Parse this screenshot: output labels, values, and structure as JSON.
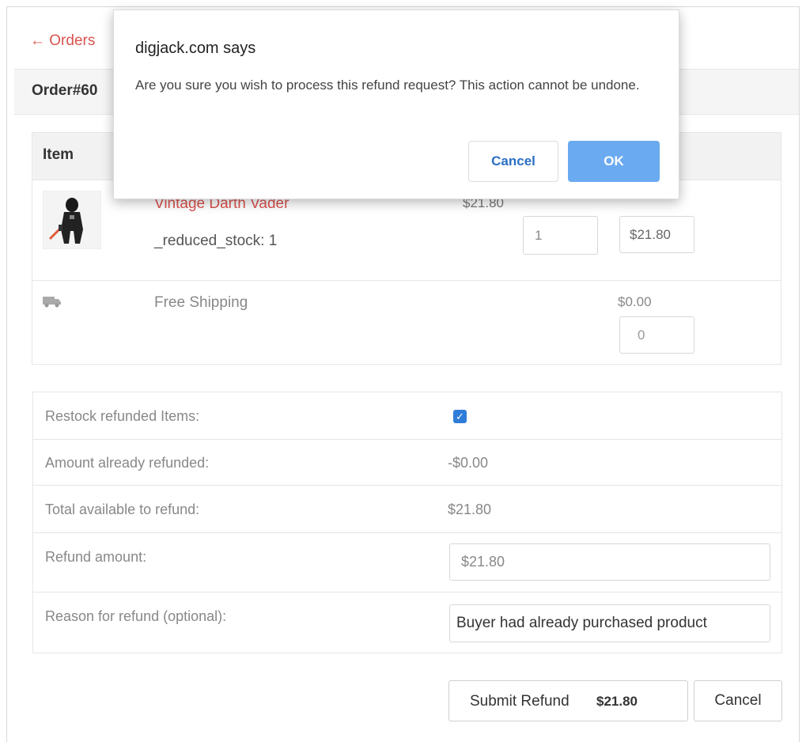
{
  "nav": {
    "back_label": "← Orders"
  },
  "order": {
    "title": "Order#60"
  },
  "items_table": {
    "header_item": "Item",
    "product": {
      "name": "Vintage Darth Vader",
      "meta": "_reduced_stock: 1",
      "unit_price": "$21.80",
      "qty_value": "1",
      "amount_value": "$21.80"
    },
    "shipping": {
      "label": "Free Shipping",
      "price": "$0.00",
      "amount_value": "0"
    }
  },
  "summary": {
    "restock_label": "Restock refunded Items:",
    "restock_checked": true,
    "already_label": "Amount already refunded:",
    "already_value": "-$0.00",
    "available_label": "Total available to refund:",
    "available_value": "$21.80",
    "amount_label": "Refund amount:",
    "amount_value": "$21.80",
    "reason_label": "Reason for refund (optional):",
    "reason_value": "Buyer had already purchased product"
  },
  "actions": {
    "submit_label": "Submit Refund",
    "submit_amount": "$21.80",
    "cancel_label": "Cancel"
  },
  "dialog": {
    "title": "digjack.com says",
    "message": "Are you sure you wish to process this refund request? This action cannot be undone.",
    "cancel_label": "Cancel",
    "ok_label": "OK"
  },
  "colors": {
    "link": "#d9534f",
    "ok_button": "#6aaaf0",
    "cancel_text": "#2b6fc4",
    "checkbox": "#2f7dd8"
  }
}
